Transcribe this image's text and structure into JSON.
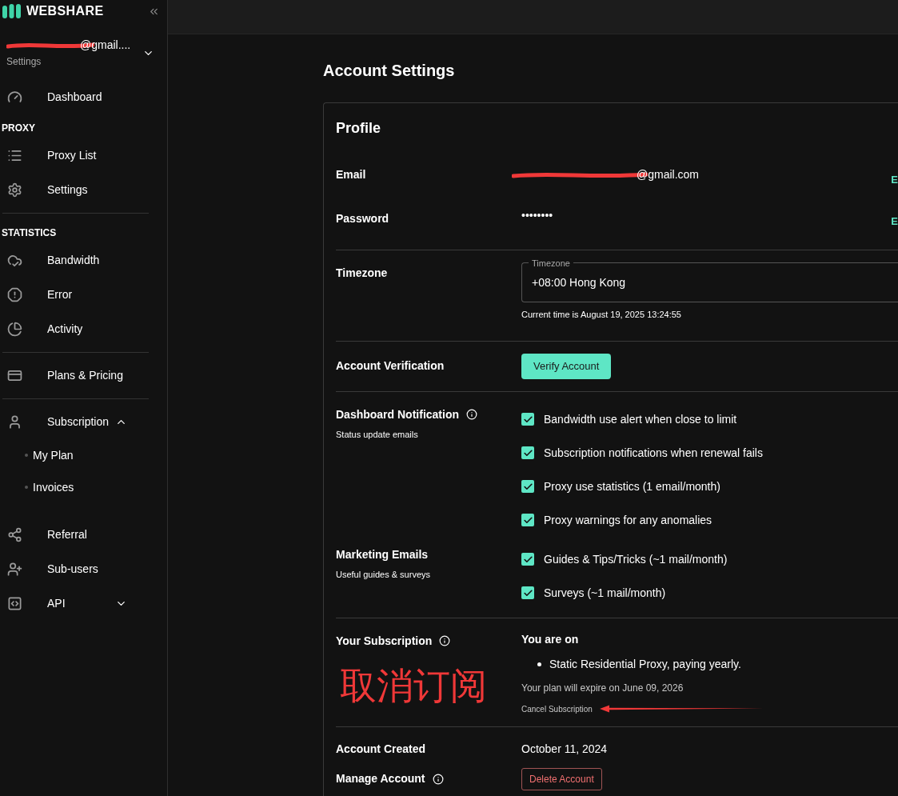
{
  "sidebar": {
    "logo": "WEBSHARE",
    "account": {
      "email": "@gmail....",
      "role": "Settings"
    },
    "nav": [
      {
        "kind": "item",
        "label": "Dashboard",
        "divider_before": false
      },
      {
        "kind": "heading",
        "label": "PROXY",
        "divider_before": false
      },
      {
        "kind": "item",
        "label": "Proxy List",
        "divider_before": false
      },
      {
        "kind": "item",
        "label": "Settings",
        "divider_before": false
      },
      {
        "kind": "heading",
        "label": "STATISTICS",
        "divider_before": true
      },
      {
        "kind": "item",
        "label": "Bandwidth",
        "divider_before": false
      },
      {
        "kind": "item",
        "label": "Error",
        "divider_before": false
      },
      {
        "kind": "item",
        "label": "Activity",
        "divider_before": false
      },
      {
        "kind": "item",
        "label": "Plans & Pricing",
        "divider_before": true
      },
      {
        "kind": "group",
        "label": "Subscription",
        "divider_before": true,
        "expanded": true,
        "children": [
          {
            "label": "My Plan"
          },
          {
            "label": "Invoices"
          }
        ]
      },
      {
        "kind": "item",
        "label": "Referral",
        "divider_before": false
      },
      {
        "kind": "item",
        "label": "Sub-users",
        "divider_before": false
      },
      {
        "kind": "group",
        "label": "API",
        "divider_before": false,
        "expanded": false
      }
    ]
  },
  "page_title": "Account Settings",
  "profile": {
    "title": "Profile",
    "email": {
      "label": "Email",
      "value": "@gmail.com",
      "action": "E"
    },
    "password": {
      "label": "Password",
      "value": "••••••••",
      "action": "E"
    },
    "timezone": {
      "label": "Timezone",
      "field_label": "Timezone",
      "value": "+08:00 Hong Kong",
      "current_time": "Current time is August 19, 2025 13:24:55"
    },
    "verification": {
      "label": "Account Verification",
      "button": "Verify Account"
    },
    "notification_groups": [
      {
        "label": "Dashboard Notification",
        "info": true,
        "subtitle": "Status update emails",
        "options": [
          {
            "label": "Bandwidth use alert when close to limit",
            "checked": true
          },
          {
            "label": "Subscription notifications when renewal fails",
            "checked": true
          },
          {
            "label": "Proxy use statistics (1 email/month)",
            "checked": true
          },
          {
            "label": "Proxy warnings for any anomalies",
            "checked": true
          }
        ]
      },
      {
        "label": "Marketing Emails",
        "info": false,
        "subtitle": "Useful guides & surveys",
        "options": [
          {
            "label": "Guides & Tips/Tricks (~1 mail/month)",
            "checked": true
          },
          {
            "label": "Surveys (~1 mail/month)",
            "checked": true
          }
        ]
      }
    ],
    "subscription": {
      "label": "Your Subscription",
      "heading": "You are on",
      "plans": [
        "Static Residential Proxy, paying yearly."
      ],
      "expiry": "Your plan will expire on June 09, 2026",
      "cancel_link": "Cancel Subscription"
    },
    "created": {
      "label": "Account Created",
      "value": "October 11, 2024"
    },
    "manage": {
      "label": "Manage Account",
      "button": "Delete Account"
    }
  },
  "annotation": {
    "text": "取消订阅"
  }
}
